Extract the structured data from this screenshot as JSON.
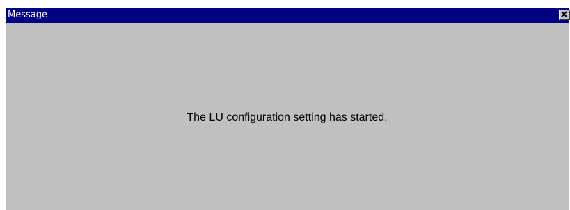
{
  "window": {
    "title": "Message",
    "close_icon": "close-icon",
    "message": "The LU configuration setting has started."
  },
  "colors": {
    "titlebar": "#000080",
    "title_text": "#ffffff",
    "window_face": "#c0c0c0",
    "message_text": "#000000"
  }
}
